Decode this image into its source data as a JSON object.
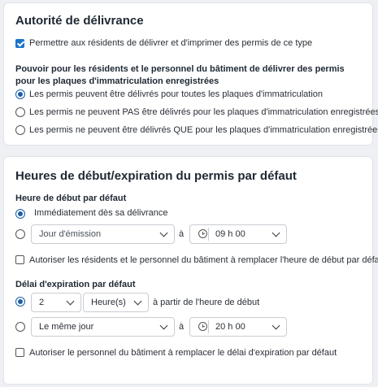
{
  "delivery_authority": {
    "title": "Autorité de délivrance",
    "allow_print_label": "Permettre aux résidents de délivrer et d'imprimer des permis de ce type",
    "allow_print_checked": true,
    "plates_heading": "Pouvoir pour les résidents et le personnel du bâtiment de délivrer des permis pour les plaques d'immatriculation enregistrées",
    "plate_options": [
      {
        "label": "Les permis peuvent être délivrés pour toutes les plaques d'immatriculation",
        "selected": true
      },
      {
        "label": "Les permis ne peuvent PAS être délivrés pour les plaques d'immatriculation enregistrées",
        "selected": false
      },
      {
        "label": "Les permis ne peuvent être délivrés QUE pour les plaques d'immatriculation enregistrées",
        "selected": false
      }
    ]
  },
  "default_times": {
    "title": "Heures de début/expiration du permis par défaut",
    "start": {
      "heading": "Heure de début par défaut",
      "immediate_label": "Immédiatement dès sa délivrance",
      "immediate_selected": true,
      "custom_selected": false,
      "day_value": "Jour d'émission",
      "at_label": "à",
      "time_value": "09 h 00",
      "override_label": "Autoriser les résidents et le personnel du bâtiment à remplacer l'heure de début par défaut",
      "override_checked": false
    },
    "expiry": {
      "heading": "Délai d'expiration par défaut",
      "duration_selected": true,
      "duration_value": "2",
      "unit_value": "Heure(s)",
      "from_start_label": "à partir de l'heure de début",
      "sameday_selected": false,
      "day_value": "Le même jour",
      "at_label": "à",
      "time_value": "20 h 00",
      "override_label": "Autoriser le personnel du bâtiment à remplacer le délai d'expiration par défaut",
      "override_checked": false
    }
  },
  "colors": {
    "accent": "#1a73c7",
    "card_background": "#ffffff",
    "page_background": "#eef0f3"
  }
}
